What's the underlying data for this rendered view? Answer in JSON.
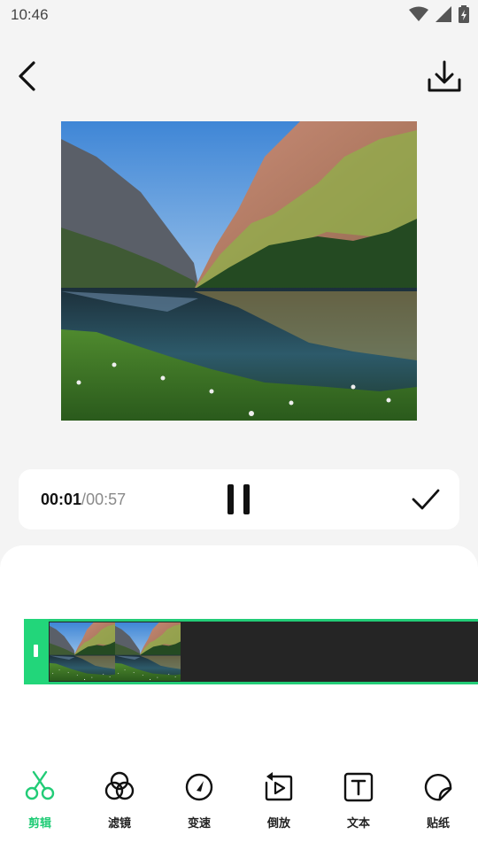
{
  "status_bar": {
    "time": "10:46",
    "icons": [
      "wifi-icon",
      "signal-icon",
      "battery-icon"
    ]
  },
  "header": {
    "back_icon": "chevron-left-icon",
    "download_icon": "download-icon"
  },
  "player": {
    "current_time": "00:01",
    "separator": "/",
    "total_time": "00:57",
    "pause_icon": "pause-icon",
    "confirm_icon": "check-icon"
  },
  "timeline": {
    "handle_icon": "trim-handle",
    "thumbnail_count": 2,
    "accent_color": "#22cc77"
  },
  "toolbar": {
    "accent_color": "#22cc77",
    "items": [
      {
        "label": "剪辑",
        "icon": "scissors-icon",
        "active": true
      },
      {
        "label": "滤镜",
        "icon": "filter-icon",
        "active": false
      },
      {
        "label": "变速",
        "icon": "speed-icon",
        "active": false
      },
      {
        "label": "倒放",
        "icon": "reverse-play-icon",
        "active": false
      },
      {
        "label": "文本",
        "icon": "text-icon",
        "active": false
      },
      {
        "label": "贴纸",
        "icon": "sticker-icon",
        "active": false
      }
    ]
  }
}
